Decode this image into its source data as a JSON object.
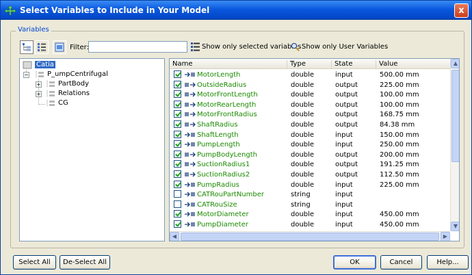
{
  "window": {
    "title": "Select Variables to Include in Your Model",
    "close_label": "x"
  },
  "group_label": "Variables",
  "toolbar": {
    "filter_label": "Filter:",
    "filter_value": "",
    "show_selected_label": "Show only selected variables",
    "show_user_label": "Show only User Variables"
  },
  "tree": {
    "root": "Catia",
    "product": "P_umpCentrifugal",
    "children": [
      "PartBody",
      "Relations",
      "CG"
    ]
  },
  "table": {
    "columns": [
      "Name",
      "Type",
      "State",
      "Value"
    ],
    "rows": [
      {
        "checked": true,
        "dir": "in",
        "name": "MotorLength",
        "type": "double",
        "state": "input",
        "value": "500.00 mm"
      },
      {
        "checked": true,
        "dir": "out",
        "name": "OutsideRadius",
        "type": "double",
        "state": "output",
        "value": "225.00 mm"
      },
      {
        "checked": true,
        "dir": "out",
        "name": "MotorFrontLength",
        "type": "double",
        "state": "output",
        "value": "100.00 mm"
      },
      {
        "checked": true,
        "dir": "out",
        "name": "MotorRearLength",
        "type": "double",
        "state": "output",
        "value": "100.00 mm"
      },
      {
        "checked": true,
        "dir": "out",
        "name": "MotorFrontRadius",
        "type": "double",
        "state": "output",
        "value": "168.75 mm"
      },
      {
        "checked": true,
        "dir": "out",
        "name": "ShaftRadius",
        "type": "double",
        "state": "output",
        "value": "84.38 mm"
      },
      {
        "checked": true,
        "dir": "in",
        "name": "ShaftLength",
        "type": "double",
        "state": "input",
        "value": "150.00 mm"
      },
      {
        "checked": true,
        "dir": "in",
        "name": "PumpLength",
        "type": "double",
        "state": "input",
        "value": "250.00 mm"
      },
      {
        "checked": true,
        "dir": "out",
        "name": "PumpBodyLength",
        "type": "double",
        "state": "output",
        "value": "200.00 mm"
      },
      {
        "checked": true,
        "dir": "out",
        "name": "SuctionRadius1",
        "type": "double",
        "state": "output",
        "value": "191.25 mm"
      },
      {
        "checked": true,
        "dir": "out",
        "name": "SuctionRadius2",
        "type": "double",
        "state": "output",
        "value": "112.50 mm"
      },
      {
        "checked": true,
        "dir": "in",
        "name": "PumpRadius",
        "type": "double",
        "state": "input",
        "value": "225.00 mm"
      },
      {
        "checked": false,
        "dir": "in",
        "name": "CATRouPartNumber",
        "type": "string",
        "state": "input",
        "value": ""
      },
      {
        "checked": false,
        "dir": "in",
        "name": "CATRouSize",
        "type": "string",
        "state": "input",
        "value": ""
      },
      {
        "checked": true,
        "dir": "in",
        "name": "MotorDiameter",
        "type": "double",
        "state": "input",
        "value": "450.00 mm"
      },
      {
        "checked": true,
        "dir": "in",
        "name": "PumpDiameter",
        "type": "double",
        "state": "input",
        "value": "450.00 mm"
      }
    ]
  },
  "buttons": {
    "select_all": "Select All",
    "deselect_all": "De-Select All",
    "ok": "OK",
    "cancel": "Cancel",
    "help": "Help..."
  }
}
